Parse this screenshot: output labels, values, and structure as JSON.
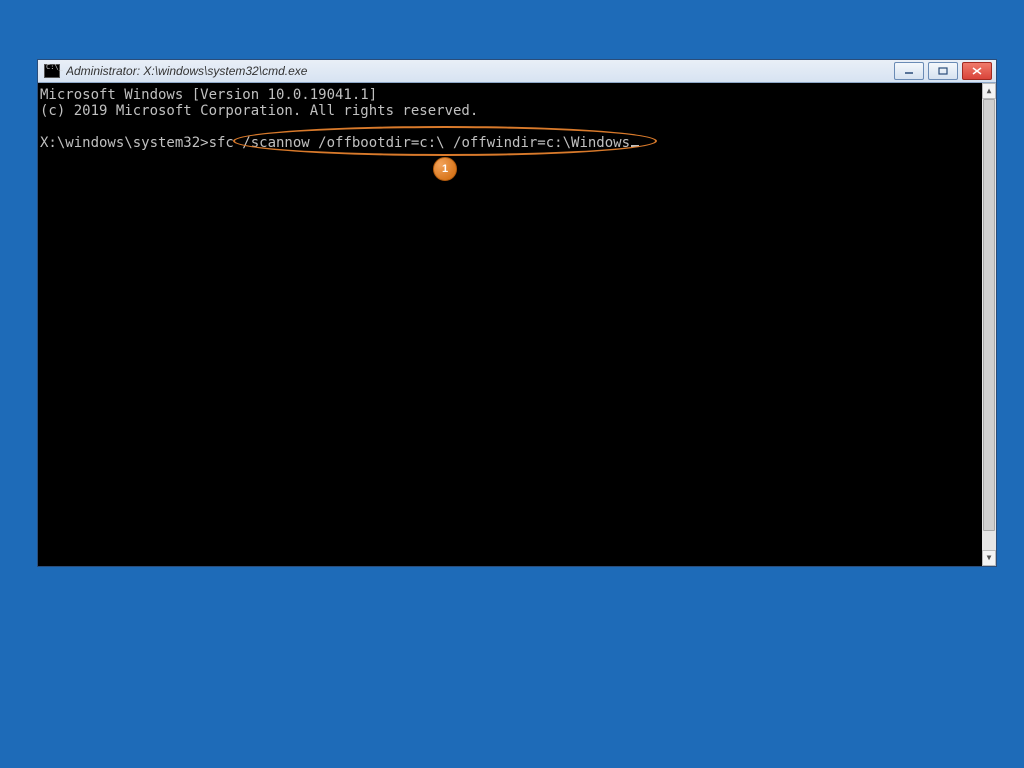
{
  "window": {
    "title": "Administrator: X:\\windows\\system32\\cmd.exe"
  },
  "console": {
    "line1": "Microsoft Windows [Version 10.0.19041.1]",
    "line2": "(c) 2019 Microsoft Corporation. All rights reserved.",
    "blank": "",
    "prompt": "X:\\windows\\system32>",
    "command": "sfc /scannow /offbootdir=c:\\ /offwindir=c:\\Windows"
  },
  "annotation": {
    "badge": "1"
  }
}
